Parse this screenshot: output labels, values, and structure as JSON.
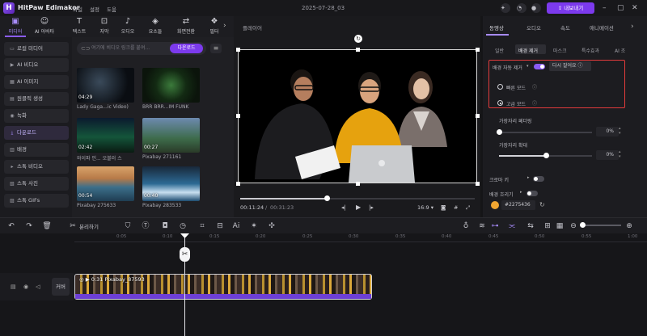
{
  "app": {
    "name": "HitPaw Edimakor",
    "project_title": "2025-07-28_03",
    "menu": [
      "파일",
      "설정",
      "도움"
    ],
    "export_label": "내보내기"
  },
  "toolbar": {
    "items": [
      {
        "label": "미디어",
        "icon": "media-icon",
        "active": true
      },
      {
        "label": "AI 아바타",
        "icon": "avatar-icon"
      },
      {
        "label": "텍스트",
        "icon": "text-icon"
      },
      {
        "label": "자막",
        "icon": "subtitle-icon"
      },
      {
        "label": "오디오",
        "icon": "audio-icon"
      },
      {
        "label": "요소들",
        "icon": "elements-icon"
      },
      {
        "label": "화면전환",
        "icon": "transition-icon"
      },
      {
        "label": "필터",
        "icon": "filter-icon"
      }
    ]
  },
  "media_sidebar": {
    "items": [
      {
        "label": "로컬 미디어",
        "icon": "folder-icon"
      },
      {
        "label": "AI 비디오",
        "icon": "ai-video-icon"
      },
      {
        "label": "AI 이미지",
        "icon": "ai-image-icon"
      },
      {
        "label": "원클릭 생성",
        "icon": "one-click-icon"
      },
      {
        "label": "녹화",
        "icon": "record-icon"
      },
      {
        "label": "다운로드",
        "icon": "download-icon",
        "active": true
      },
      {
        "label": "배경",
        "icon": "background-icon"
      },
      {
        "label": "스톡 비디오",
        "icon": "stock-video-icon"
      },
      {
        "label": "스톡 사진",
        "icon": "stock-photo-icon"
      },
      {
        "label": "스톡 GIFs",
        "icon": "gif-icon"
      }
    ]
  },
  "media_panel": {
    "search_placeholder": "여기에 비디오 링크를 붙여...",
    "download_button": "다운로드",
    "items": [
      {
        "duration": "04:29",
        "caption": "Lady Gaga...ic Video)"
      },
      {
        "duration": "",
        "caption": "BRR BRR...IM FUNK"
      },
      {
        "duration": "02:42",
        "caption": "와이파 인... 오블러 스"
      },
      {
        "duration": "00:27",
        "caption": "Pixabay 271161"
      },
      {
        "duration": "00:54",
        "caption": "Pixabay 275633"
      },
      {
        "duration": "00:40",
        "caption": "Pixabay 283533"
      }
    ]
  },
  "player": {
    "label": "플레이어",
    "current_time": "00:11:24",
    "total_time": "00:31:23",
    "aspect": "16:9",
    "progress": 0.37
  },
  "properties": {
    "tabs": [
      "동영상",
      "오디오",
      "속도",
      "애니메이션"
    ],
    "subtabs": [
      "일반",
      "배경 제거",
      "마스크",
      "특수효과",
      "AI 조"
    ],
    "bg_remove": {
      "label": "배경 자동 제거",
      "enabled": true,
      "retry_label": "다시 잘어요",
      "options": [
        {
          "label": "빠른 모드",
          "selected": false
        },
        {
          "label": "고급 모드",
          "selected": true
        }
      ]
    },
    "edge_feather": {
      "label": "가장자리 페더링",
      "value": "0%",
      "level": 0
    },
    "edge_expand": {
      "label": "가장자리 확대",
      "value": "0%",
      "level": 0.5
    },
    "chroma_key": {
      "label": "크로마 키",
      "enabled": false
    },
    "bg_blur": {
      "label": "배경 흐리기",
      "enabled": false
    },
    "color_hex": "#2275436"
  },
  "timeline": {
    "ticks": [
      "0:05",
      "0:10",
      "0:15",
      "0:20",
      "0:25",
      "0:30",
      "0:35",
      "0:40",
      "0:45",
      "0:50",
      "0:55",
      "1:00"
    ],
    "split_label": "분리하기",
    "cover_label": "커버",
    "clip_label": "0:31 Pixabay_87593"
  }
}
